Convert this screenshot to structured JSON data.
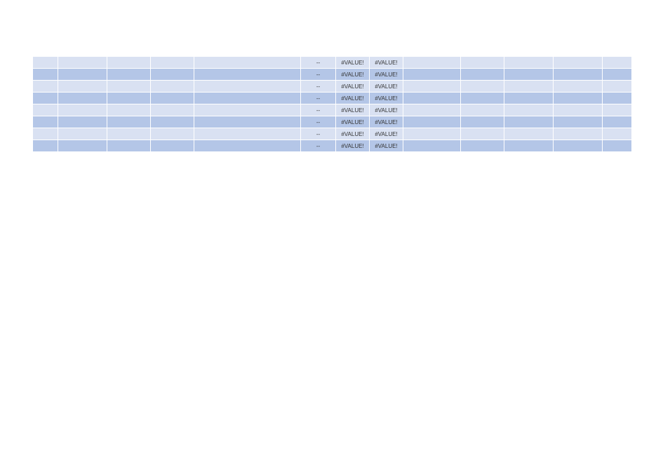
{
  "chart_data": {
    "type": "table",
    "title": "",
    "columns": [
      "",
      "",
      "",
      "",
      "",
      "",
      "",
      "",
      "",
      "",
      "",
      "",
      ""
    ],
    "rows": [
      [
        "",
        "",
        "",
        "",
        "",
        "--",
        "#VALUE!",
        "#VALUE!",
        "",
        "",
        "",
        "",
        ""
      ],
      [
        "",
        "",
        "",
        "",
        "",
        "--",
        "#VALUE!",
        "#VALUE!",
        "",
        "",
        "",
        "",
        ""
      ],
      [
        "",
        "",
        "",
        "",
        "",
        "--",
        "#VALUE!",
        "#VALUE!",
        "",
        "",
        "",
        "",
        ""
      ],
      [
        "",
        "",
        "",
        "",
        "",
        "--",
        "#VALUE!",
        "#VALUE!",
        "",
        "",
        "",
        "",
        ""
      ],
      [
        "",
        "",
        "",
        "",
        "",
        "--",
        "#VALUE!",
        "#VALUE!",
        "",
        "",
        "",
        "",
        ""
      ],
      [
        "",
        "",
        "",
        "",
        "",
        "--",
        "#VALUE!",
        "#VALUE!",
        "",
        "",
        "",
        "",
        ""
      ],
      [
        "",
        "",
        "",
        "",
        "",
        "--",
        "#VALUE!",
        "#VALUE!",
        "",
        "",
        "",
        "",
        ""
      ],
      [
        "",
        "",
        "",
        "",
        "",
        "--",
        "#VALUE!",
        "#VALUE!",
        "",
        "",
        "",
        "",
        ""
      ]
    ]
  },
  "colors": {
    "row_even": "#d9e1f2",
    "row_odd": "#b4c6e7",
    "grid": "#ffffff",
    "text": "#333333"
  }
}
